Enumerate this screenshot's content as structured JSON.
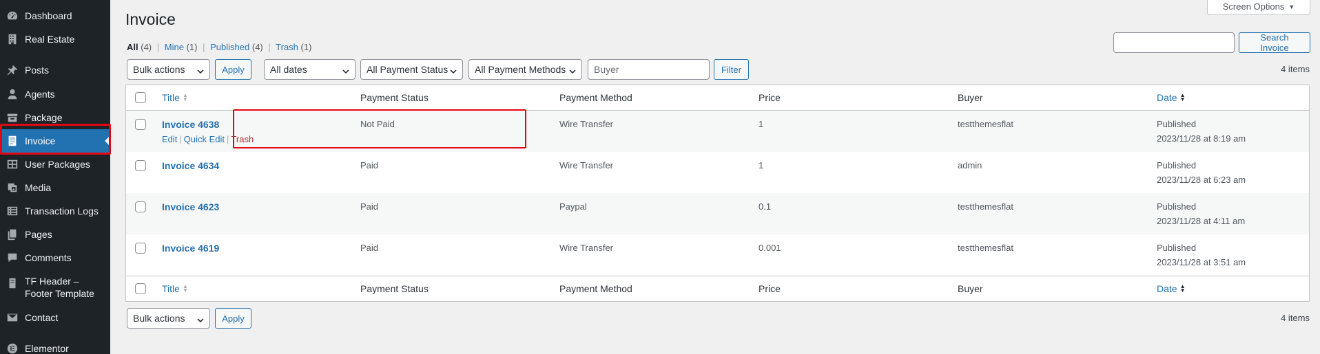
{
  "sidebar": {
    "items": [
      {
        "label": "Dashboard",
        "icon": "dashboard-icon"
      },
      {
        "label": "Real Estate",
        "icon": "building-icon"
      },
      {
        "label": "Posts",
        "icon": "pin-icon"
      },
      {
        "label": "Agents",
        "icon": "user-icon"
      },
      {
        "label": "Package",
        "icon": "archive-icon"
      },
      {
        "label": "Invoice",
        "icon": "document-icon"
      },
      {
        "label": "User Packages",
        "icon": "grid-icon"
      },
      {
        "label": "Media",
        "icon": "media-icon"
      },
      {
        "label": "Transaction Logs",
        "icon": "list-icon"
      },
      {
        "label": "Pages",
        "icon": "pages-icon"
      },
      {
        "label": "Comments",
        "icon": "comment-icon"
      },
      {
        "label": "TF Header –",
        "label2": "Footer Template",
        "icon": "template-icon"
      },
      {
        "label": "Contact",
        "icon": "mail-icon"
      },
      {
        "label": "Elementor",
        "icon": "elementor-icon"
      }
    ]
  },
  "header": {
    "title": "Invoice",
    "screen_options": "Screen Options"
  },
  "filters_links": {
    "all": "All",
    "all_count": "(4)",
    "mine": "Mine",
    "mine_count": "(1)",
    "published": "Published",
    "published_count": "(4)",
    "trash": "Trash",
    "trash_count": "(1)",
    "sep": "|"
  },
  "search": {
    "button": "Search Invoice",
    "value": ""
  },
  "tablenav": {
    "bulk_actions": "Bulk actions",
    "apply": "Apply",
    "dates": "All dates",
    "payment_status": "All Payment Status",
    "payment_methods": "All Payment Methods",
    "buyer_placeholder": "Buyer",
    "filter": "Filter",
    "items_count": "4 items"
  },
  "table": {
    "columns": {
      "title": "Title",
      "status": "Payment Status",
      "method": "Payment Method",
      "price": "Price",
      "buyer": "Buyer",
      "date": "Date"
    },
    "row_actions": {
      "edit": "Edit",
      "quick_edit": "Quick Edit",
      "trash": "Trash",
      "sep": "|"
    },
    "rows": [
      {
        "title": "Invoice 4638",
        "status": "Not Paid",
        "method": "Wire Transfer",
        "price": "1",
        "buyer": "testthemesflat",
        "date_status": "Published",
        "date": "2023/11/28 at 8:19 am"
      },
      {
        "title": "Invoice 4634",
        "status": "Paid",
        "method": "Wire Transfer",
        "price": "1",
        "buyer": "admin",
        "date_status": "Published",
        "date": "2023/11/28 at 6:23 am"
      },
      {
        "title": "Invoice 4623",
        "status": "Paid",
        "method": "Paypal",
        "price": "0.1",
        "buyer": "testthemesflat",
        "date_status": "Published",
        "date": "2023/11/28 at 4:11 am"
      },
      {
        "title": "Invoice 4619",
        "status": "Paid",
        "method": "Wire Transfer",
        "price": "0.001",
        "buyer": "testthemesflat",
        "date_status": "Published",
        "date": "2023/11/28 at 3:51 am"
      }
    ]
  },
  "colors": {
    "accent": "#2271b1",
    "sidebar": "#1d2327",
    "highlight": "#e30613",
    "trash": "#b32d2e"
  }
}
